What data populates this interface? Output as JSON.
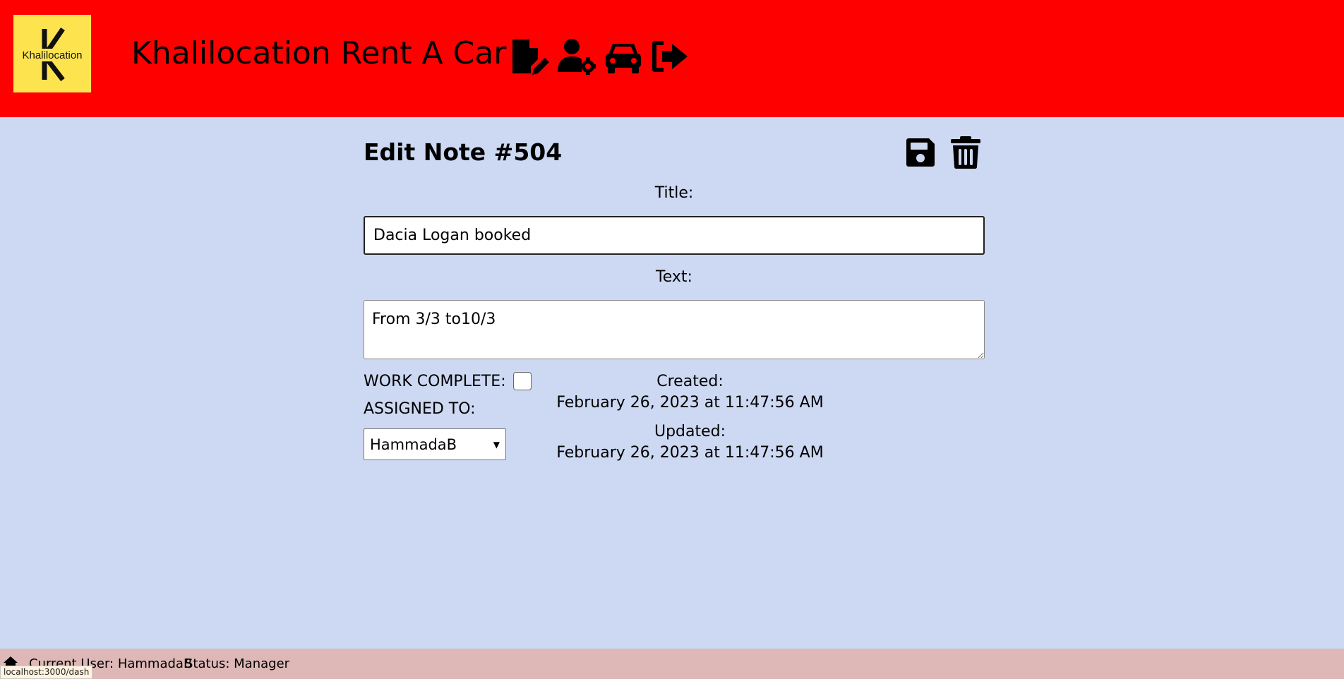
{
  "header": {
    "logo_text": "Khalilocation",
    "brand": "Khalilocation Rent A Car",
    "nav": [
      {
        "icon": "file-pen-icon"
      },
      {
        "icon": "user-gear-icon"
      },
      {
        "icon": "car-icon"
      },
      {
        "icon": "logout-icon"
      }
    ]
  },
  "form": {
    "heading": "Edit Note #504",
    "save_icon": "floppy-disk-icon",
    "delete_icon": "trash-can-icon",
    "title_label": "Title:",
    "title_value": "Dacia Logan booked",
    "text_label": "Text:",
    "text_value": "From 3/3 to10/3",
    "work_complete_label": "WORK COMPLETE:",
    "work_complete_checked": false,
    "assigned_label": "ASSIGNED TO:",
    "assigned_value": "HammadaB",
    "created_label": "Created:",
    "created_value": "February 26, 2023 at 11:47:56 AM",
    "updated_label": "Updated:",
    "updated_value": "February 26, 2023 at 11:47:56 AM"
  },
  "footer": {
    "current_user": "Current User: HammadaB",
    "status": "Status: Manager",
    "link_preview": "localhost:3000/dash"
  },
  "colors": {
    "header_bg": "#ff0000",
    "page_bg": "#cdd9f3",
    "footer_bg": "#ddb8b6",
    "logo_bg": "#fde44f"
  }
}
